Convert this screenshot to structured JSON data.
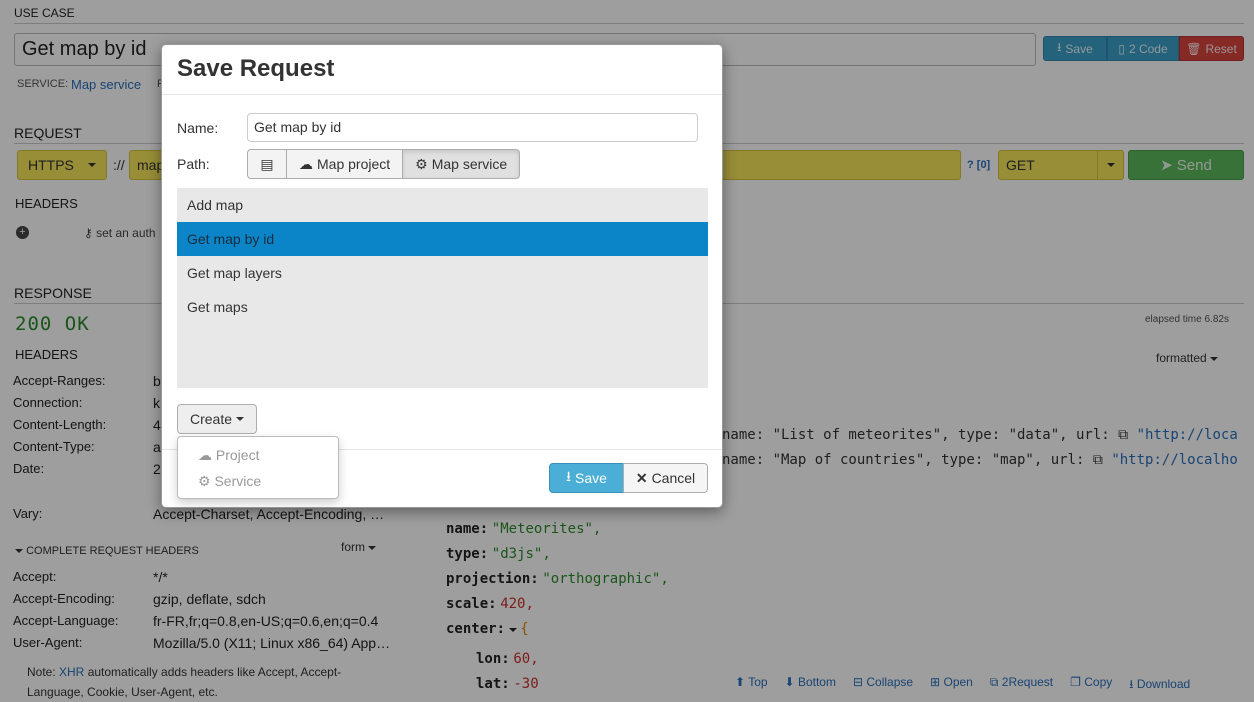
{
  "usecase": {
    "section_label": "USE CASE",
    "title_value": "Get map by id",
    "save_label": "Save",
    "code_label": "2 Code",
    "reset_label": "Reset",
    "service_label": "SERVICE:",
    "service_value": "Map service",
    "extra_letter": "F"
  },
  "request": {
    "section_label": "REQUEST",
    "protocol": "HTTPS",
    "separator": "://",
    "url_partial": "map",
    "param_count": "? [0]",
    "method": "GET",
    "send_label": "Send",
    "headers_label": "HEADERS",
    "auth_hint": "set an auth"
  },
  "response": {
    "section_label": "RESPONSE",
    "status": "200 OK",
    "elapsed": "elapsed time 6.82s",
    "headers_label": "HEADERS",
    "format": "formatted",
    "headers": [
      {
        "name": "Accept-Ranges:",
        "value": "b"
      },
      {
        "name": "Connection:",
        "value": "k"
      },
      {
        "name": "Content-Length:",
        "value": "4"
      },
      {
        "name": "Content-Type:",
        "value": "a"
      },
      {
        "name": "Date:",
        "value": "2"
      },
      {
        "name": "Vary:",
        "value": "Accept-Charset, Accept-Encoding, …"
      }
    ],
    "complete_label": "COMPLETE REQUEST HEADERS",
    "form_label": "form",
    "req_headers": [
      {
        "name": "Accept:",
        "value": "*/*"
      },
      {
        "name": "Accept-Encoding:",
        "value": "gzip, deflate, sdch"
      },
      {
        "name": "Accept-Language:",
        "value": "fr-FR,fr;q=0.8,en-US;q=0.6,en;q=0.4"
      },
      {
        "name": "User-Agent:",
        "value": "Mozilla/5.0 (X11; Linux x86_64) App…"
      }
    ],
    "note_prefix": "Note: ",
    "note_link": "XHR",
    "note_rest": " automatically adds headers like Accept, Accept-Language, Cookie, User-Agent, etc."
  },
  "json": {
    "line1": "name:  \"List of meteorites\", type:  \"data\", url:",
    "line1_url": "\"http://loca",
    "line2": "name:  \"Map of countries\", type:  \"map\", url:",
    "line2_url": "\"http://localho",
    "fields": [
      {
        "key": "name:",
        "value": "\"Meteorites\",",
        "kind": "str"
      },
      {
        "key": "type:",
        "value": "\"d3js\",",
        "kind": "str"
      },
      {
        "key": "projection:",
        "value": "\"orthographic\",",
        "kind": "str"
      },
      {
        "key": "scale:",
        "value": "420,",
        "kind": "num"
      },
      {
        "key": "center:",
        "value": "{",
        "kind": "brace"
      },
      {
        "key": "lon:",
        "value": "60,",
        "kind": "num"
      },
      {
        "key": "lat:",
        "value": "-30",
        "kind": "num"
      }
    ]
  },
  "toolbar": {
    "top": "Top",
    "bottom": "Bottom",
    "collapse": "Collapse",
    "open": "Open",
    "to_request": "2Request",
    "copy": "Copy",
    "download": "Download"
  },
  "modal": {
    "title": "Save Request",
    "name_label": "Name:",
    "name_value": "Get map by id",
    "path_label": "Path:",
    "path_project": "Map project",
    "path_service": "Map service",
    "items": [
      "Add map",
      "Get map by id",
      "Get map layers",
      "Get maps"
    ],
    "selected_index": 1,
    "create_label": "Create",
    "dropdown": [
      "Project",
      "Service"
    ],
    "save_label": "Save",
    "cancel_label": "Cancel"
  },
  "colors": {
    "accent": "#0b85c8",
    "yellow": "#f5e65b",
    "send_green": "#5cb85c",
    "reset_red": "#d9443e"
  }
}
